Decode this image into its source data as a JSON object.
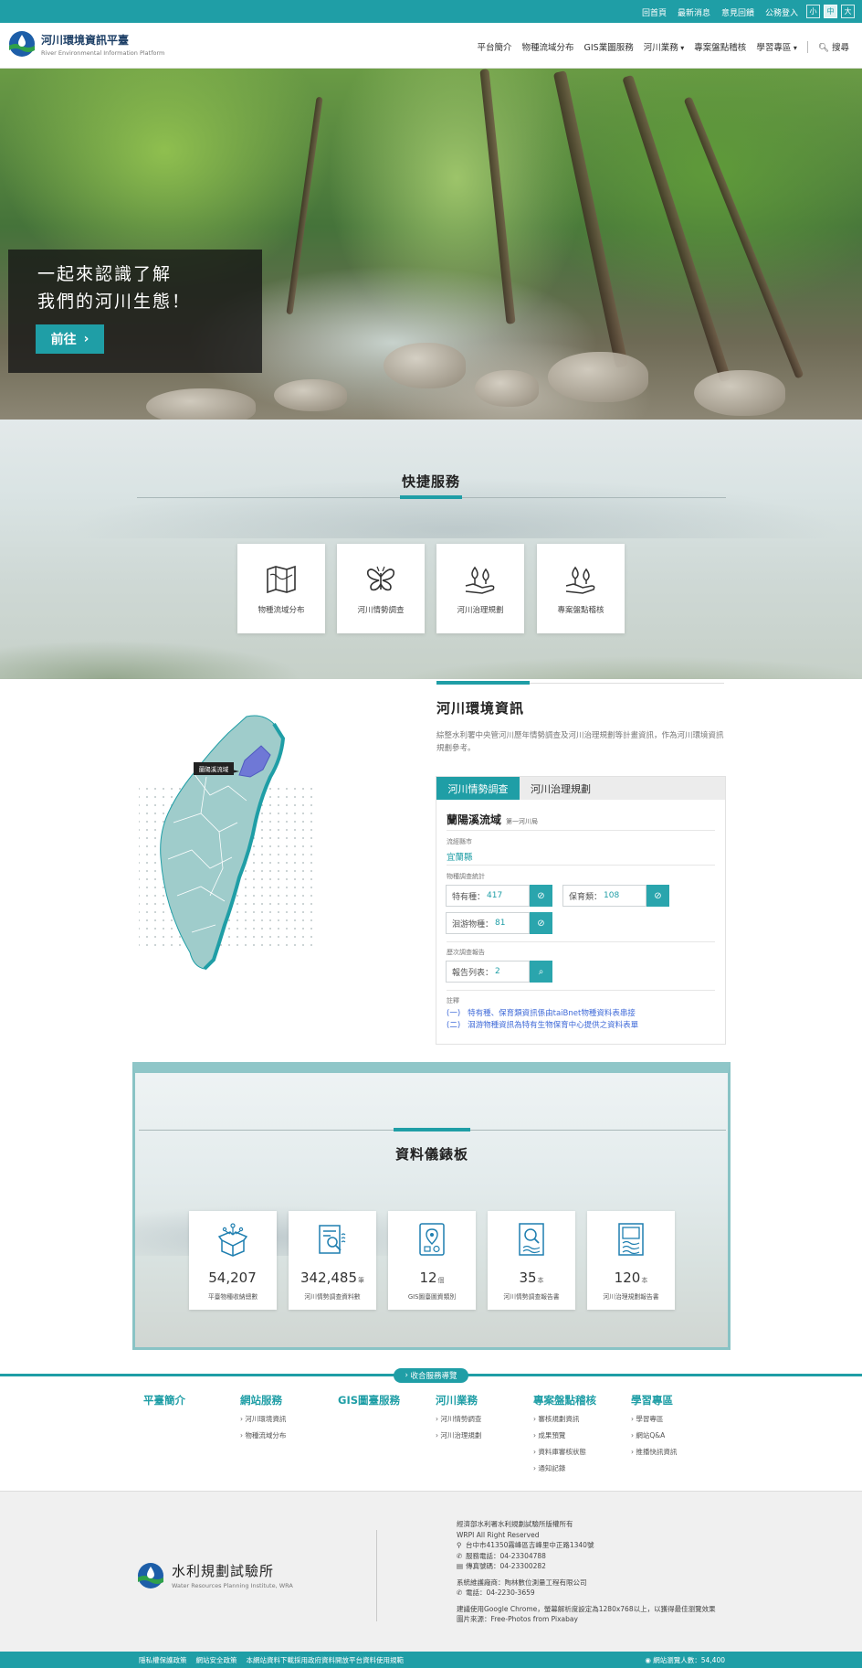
{
  "topbar": {
    "links": [
      "回首頁",
      "最新消息",
      "意見回饋",
      "公務登入"
    ],
    "font_sizes": [
      "小",
      "中",
      "大"
    ]
  },
  "header": {
    "title": "河川環境資訊平臺",
    "subtitle": "River Environmental Information Platform",
    "nav": [
      {
        "label": "平台簡介",
        "dropdown": false
      },
      {
        "label": "物種流域分布",
        "dropdown": false
      },
      {
        "label": "GIS業圖服務",
        "dropdown": false
      },
      {
        "label": "河川業務",
        "dropdown": true
      },
      {
        "label": "專案盤點稽核",
        "dropdown": false
      },
      {
        "label": "學習專區",
        "dropdown": true
      }
    ],
    "search_label": "搜尋"
  },
  "hero": {
    "line1": "一起來認識了解",
    "line2": "我們的河川生態！",
    "button": "前往"
  },
  "quick_services": {
    "title": "快捷服務",
    "items": [
      "物種流域分布",
      "河川情勢調查",
      "河川治理規劃",
      "專案盤點稽核"
    ]
  },
  "river_info": {
    "title": "河川環境資訊",
    "desc": "綜整水利署中央管河川歷年情勢調查及河川治理規劃等計畫資訊，作為河川環境資訊規劃參考。",
    "map_label": "蘭陽溪流域",
    "tabs": [
      "河川情勢調查",
      "河川治理規劃"
    ],
    "basin": "蘭陽溪流域",
    "basin_tag": "第一河川局",
    "county_label": "流經縣市",
    "county": "宜蘭縣",
    "stats_label": "物種調查統計",
    "stats": [
      {
        "label": "特有種：",
        "value": "417"
      },
      {
        "label": "保育類：",
        "value": "108"
      },
      {
        "label": "洄游物種：",
        "value": "81"
      }
    ],
    "report_label": "歷次調查報告",
    "report": {
      "label": "報告列表：",
      "value": "2"
    },
    "notes_label": "註釋",
    "notes": [
      {
        "n": "(一)",
        "text": "特有種、保育類資訊係由taiBnet物種資料表串接"
      },
      {
        "n": "(二)",
        "text": "洄游物種資訊為特有生物保育中心提供之資料表單"
      }
    ]
  },
  "dashboard": {
    "title": "資料儀錶板",
    "cards": [
      {
        "value": "54,207",
        "unit": "",
        "caption": "平臺物種收納總數"
      },
      {
        "value": "342,485",
        "unit": "筆",
        "caption": "河川情勢調查資料數"
      },
      {
        "value": "12",
        "unit": "個",
        "caption": "GIS圖臺圖資類別"
      },
      {
        "value": "35",
        "unit": "本",
        "caption": "河川情勢調查報告書"
      },
      {
        "value": "120",
        "unit": "本",
        "caption": "河川治理規劃報告書"
      }
    ]
  },
  "sitemap": {
    "toggle": "收合服務導覽",
    "columns": [
      {
        "title": "平臺簡介",
        "items": []
      },
      {
        "title": "網站服務",
        "items": [
          "河川環境資訊",
          "物種流域分布"
        ]
      },
      {
        "title": "GIS圖臺服務",
        "items": []
      },
      {
        "title": "河川業務",
        "items": [
          "河川情勢調查",
          "河川治理規劃"
        ]
      },
      {
        "title": "專案盤點稽核",
        "items": [
          "審核規劃資訊",
          "成果預覽",
          "資料庫審核狀態",
          "通知記錄"
        ]
      },
      {
        "title": "學習專區",
        "items": [
          "學習專區",
          "網站Q&A",
          "推播快訊資訊"
        ]
      }
    ]
  },
  "footer": {
    "org_name": "水利規劃試驗所",
    "org_en": "Water Resources Planning Institute, WRA",
    "copyright": "經濟部水利署水利規劃試驗所版權所有",
    "rights": "WRPI All Right Reserved",
    "address": "台中市41350霧峰區吉峰里中正路1340號",
    "phone": "服務電話：04-23304788",
    "fax": "傳真號碼：04-23300282",
    "vendor": "系統維護廠商：陶林數位測量工程有限公司",
    "vendor_phone": "電話：04-2230-3659",
    "browser_note": "建議使用Google Chrome，螢幕解析度設定為1280x768以上，以獲得最佳瀏覽效果",
    "image_source": "圖片來源：Free-Photos from Pixabay"
  },
  "bottombar": {
    "links": [
      "隱私權保護政策",
      "網站安全政策",
      "本網站資料下載採用政府資料開放平台資料使用規範"
    ],
    "visitors": "網站瀏覽人數：54,400"
  },
  "colors": {
    "primary": "#1f9ea6",
    "link": "#3f6ad8",
    "map_fill": "#9fcccb",
    "map_highlight": "#6f78d6"
  }
}
